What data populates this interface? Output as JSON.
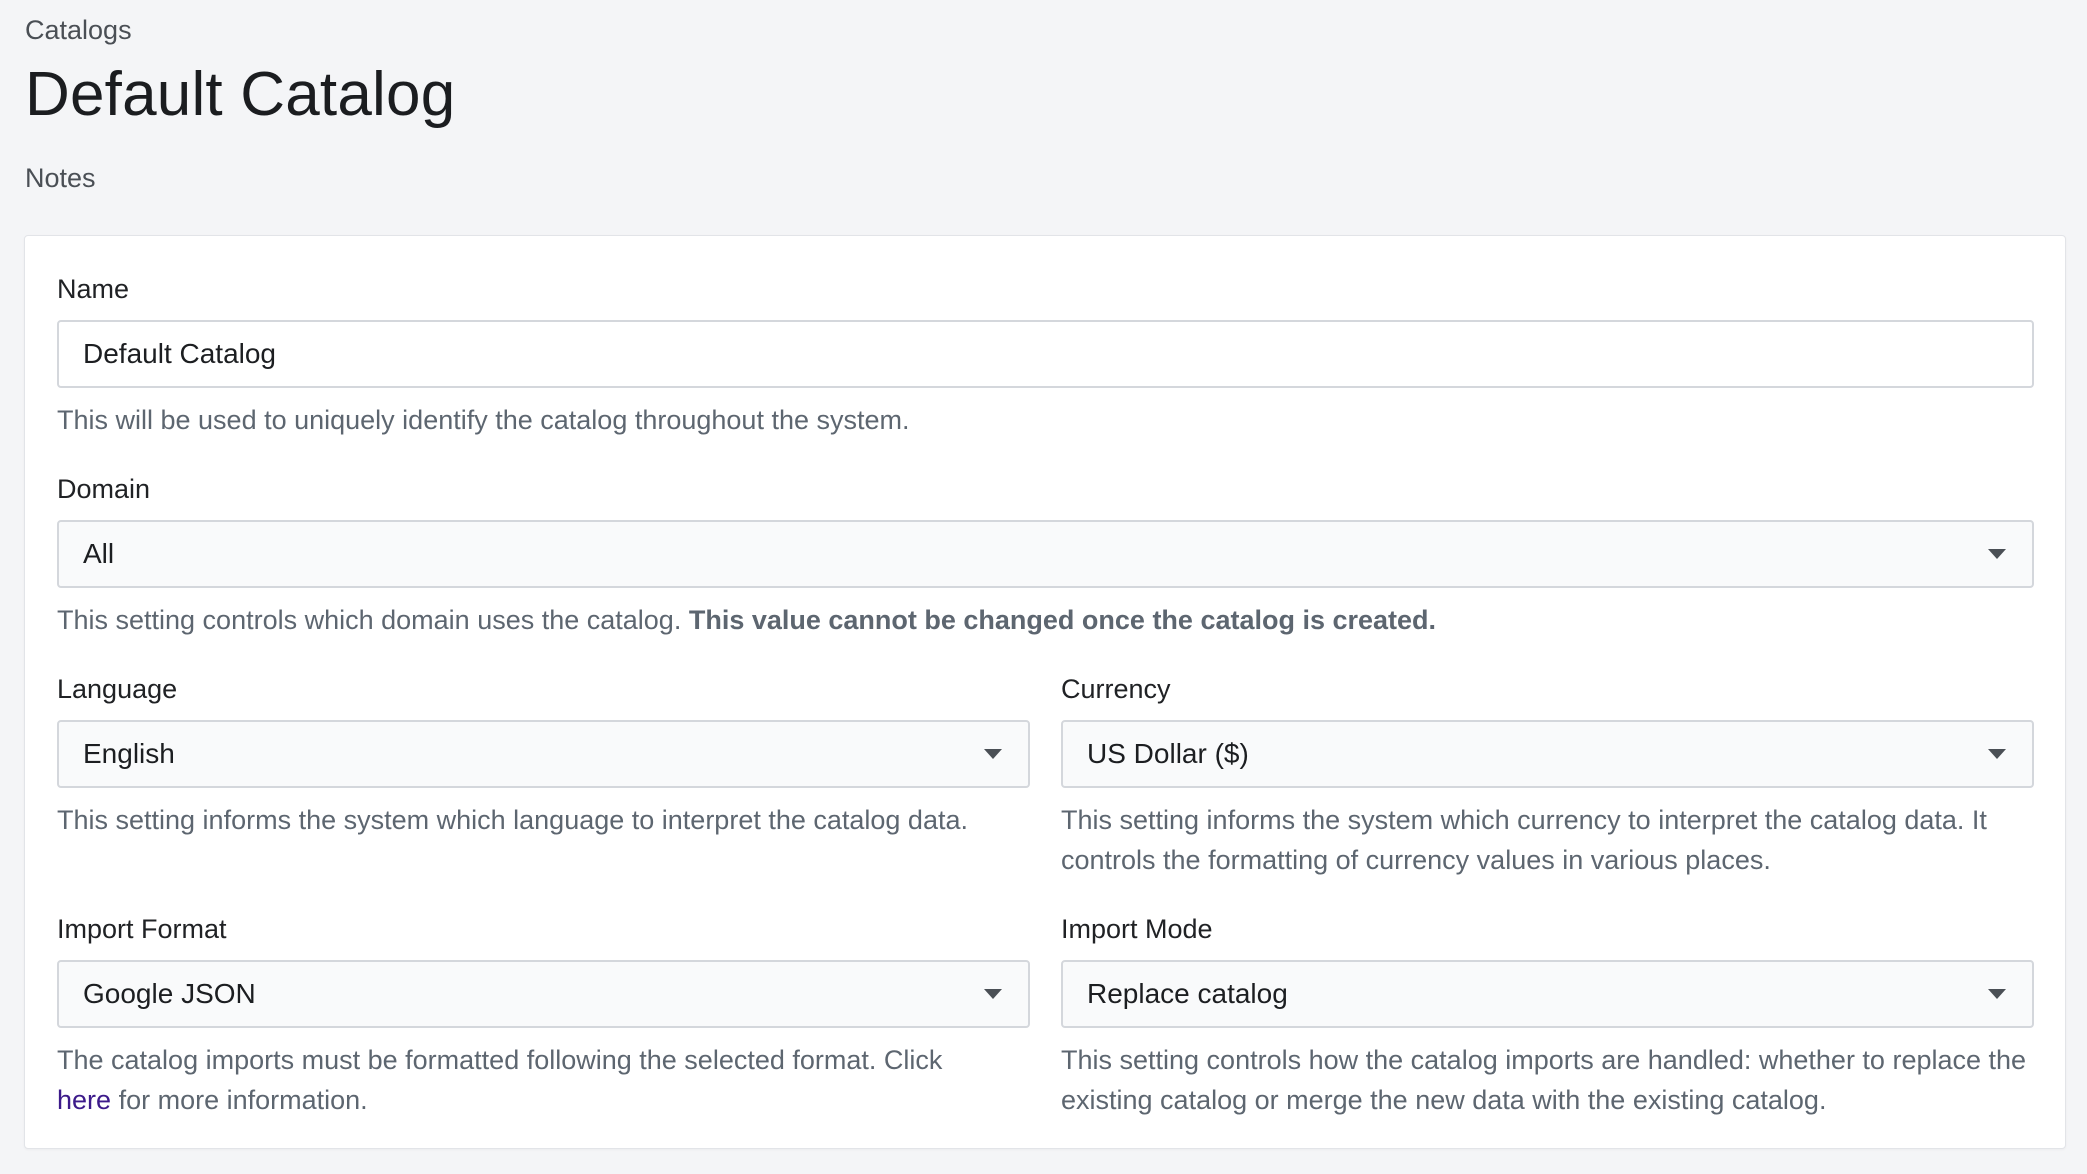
{
  "header": {
    "breadcrumb": "Catalogs",
    "title": "Default Catalog",
    "notes": "Notes"
  },
  "form": {
    "name": {
      "label": "Name",
      "value": "Default Catalog",
      "help": "This will be used to uniquely identify the catalog throughout the system."
    },
    "domain": {
      "label": "Domain",
      "value": "All",
      "help": "This setting controls which domain uses the catalog.",
      "help_bold": "This value cannot be changed once the catalog is created."
    },
    "language": {
      "label": "Language",
      "value": "English",
      "help": "This setting informs the system which language to interpret the catalog data."
    },
    "currency": {
      "label": "Currency",
      "value": "US Dollar ($)",
      "help": "This setting informs the system which currency to interpret the catalog data. It controls the formatting of currency values in various places."
    },
    "import_format": {
      "label": "Import Format",
      "value": "Google JSON",
      "help_before": "The catalog imports must be formatted following the selected format. Click",
      "help_link": "here",
      "help_after": "for more information."
    },
    "import_mode": {
      "label": "Import Mode",
      "value": "Replace catalog",
      "help": "This setting controls how the catalog imports are handled: whether to replace the existing catalog or merge the new data with the existing catalog."
    }
  },
  "colors": {
    "background": "#f4f5f7",
    "card": "#ffffff",
    "border": "#d4d7dc",
    "help_text": "#5d6670",
    "link": "#3c1a8a"
  }
}
